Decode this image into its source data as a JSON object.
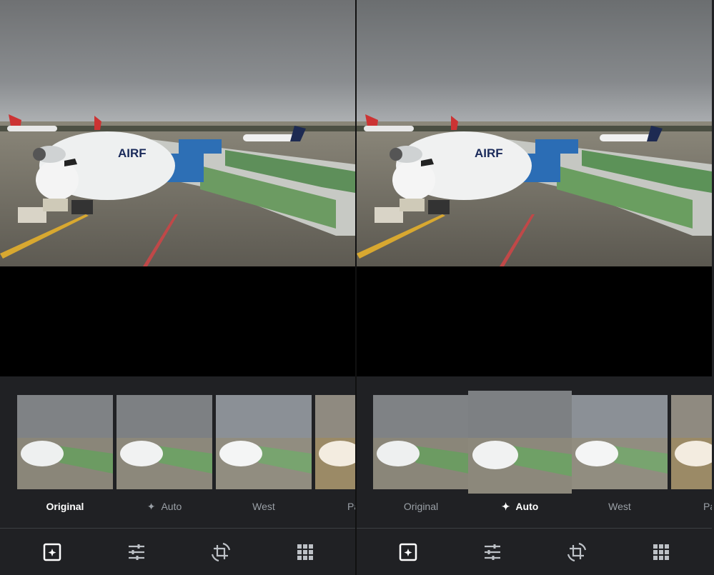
{
  "editor_left": {
    "filters": [
      {
        "label": "Original",
        "state": "selected"
      },
      {
        "label": "Auto",
        "icon": "sparkle-icon"
      },
      {
        "label": "West"
      },
      {
        "label": "Pa"
      }
    ]
  },
  "editor_right": {
    "filters": [
      {
        "label": "Original"
      },
      {
        "label": "Auto",
        "icon": "sparkle-icon",
        "state": "selected"
      },
      {
        "label": "West"
      },
      {
        "label": "Pa"
      }
    ]
  },
  "photo": {
    "aircraft_text": "AIRF"
  },
  "toolbar": {
    "tools": [
      "auto-enhance-icon",
      "adjust-sliders-icon",
      "crop-rotate-icon",
      "grid-icon"
    ]
  },
  "colors": {
    "background": "#202124",
    "active_label": "#ffffff",
    "inactive_label": "#9aa0a6",
    "divider": "#3c4043"
  }
}
